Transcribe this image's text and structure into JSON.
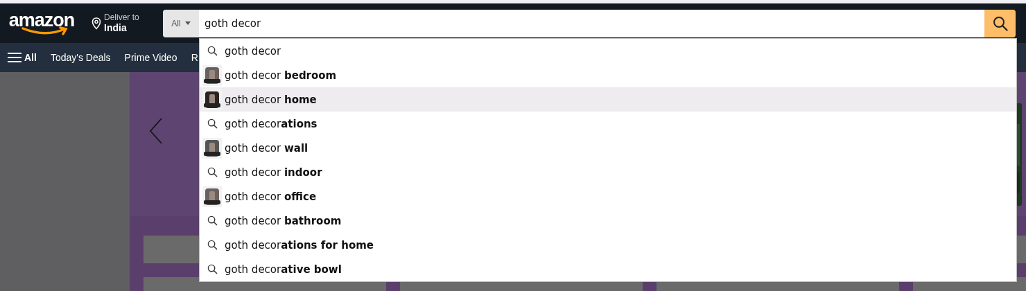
{
  "header": {
    "logo": "amazon",
    "deliver_label": "Deliver to",
    "deliver_location": "India",
    "search": {
      "category": "All",
      "value": "goth decor"
    }
  },
  "nav": [
    {
      "label": "All",
      "kind": "menu"
    },
    {
      "label": "Today's Deals",
      "kind": "link"
    },
    {
      "label": "Prime Video",
      "kind": "link"
    },
    {
      "label": "R",
      "kind": "link"
    }
  ],
  "suggestions": [
    {
      "text": "goth decor",
      "kind": "search",
      "selected": false
    },
    {
      "text": "goth decor **bedroom**",
      "selected": false
    },
    {
      "text": "goth decor **home**",
      "selected": true
    },
    {
      "text": "goth decor**ations**",
      "kind": "search",
      "selected": false
    },
    {
      "text": "goth decor **wall**",
      "selected": false
    },
    {
      "text": "goth decor **indoor**",
      "kind": "search",
      "selected": false
    },
    {
      "text": "goth decor **office**",
      "selected": false
    },
    {
      "text": "goth decor **bathroom**",
      "kind": "search",
      "selected": false
    },
    {
      "text": "goth decor**ations for home**",
      "kind": "search",
      "selected": false
    },
    {
      "text": "goth decor**ative bowl**",
      "kind": "search",
      "selected": false
    }
  ]
}
